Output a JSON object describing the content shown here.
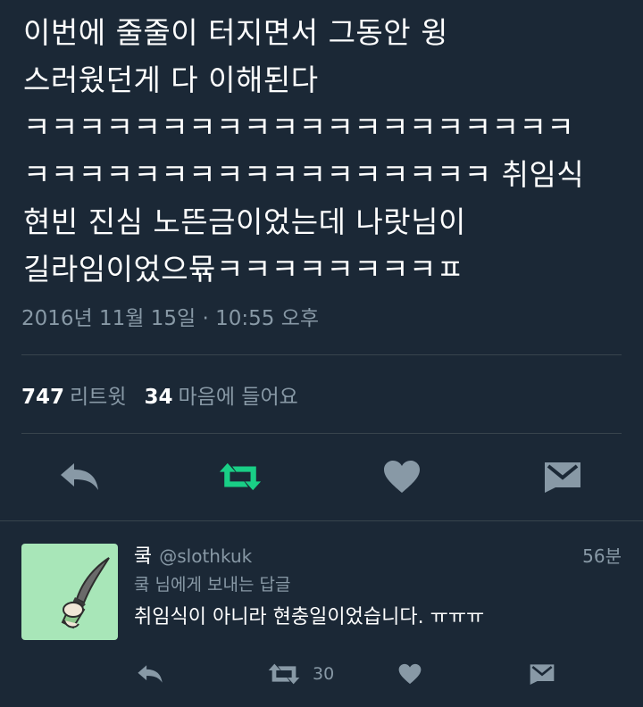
{
  "tweet": {
    "lines": [
      "이번에 줄줄이 터지면서 그동안 윙",
      "스러웠던게 다 이해된다",
      "ㅋㅋㅋㅋㅋㅋㅋㅋㅋㅋㅋㅋㅋㅋㅋㅋㅋㅋㅋㅋ",
      "ㅋㅋㅋㅋㅋㅋㅋㅋㅋㅋㅋㅋㅋㅋㅋㅋㅋ 취임식",
      "현빈 진심 노뜬금이었는데 나랏님이",
      "길라임이었으뮦ㅋㅋㅋㅋㅋㅋㅋㅋㅍ"
    ],
    "timestamp": "2016년 11월 15일 · 10:55 오후",
    "retweets_count": "747",
    "retweets_label": "리트윗",
    "likes_count": "34",
    "likes_label": "마음에 들어요"
  },
  "actions": {
    "reply_icon": "reply-icon",
    "retweet_icon": "retweet-icon",
    "like_icon": "heart-icon",
    "dm_icon": "envelope-icon"
  },
  "reply": {
    "name": "쿸",
    "handle": "@slothkuk",
    "time": "56분",
    "replying_to": "쿸 님에게 보내는 답글",
    "text": "취임식이 아니라 현충일이었습니다. ㅠㅠㅠ",
    "retweet_count": "30"
  },
  "colors": {
    "background": "#1b2836",
    "retweet_active": "#19cf86",
    "muted": "#8899a6",
    "avatar_bg": "#a8e6b8"
  }
}
